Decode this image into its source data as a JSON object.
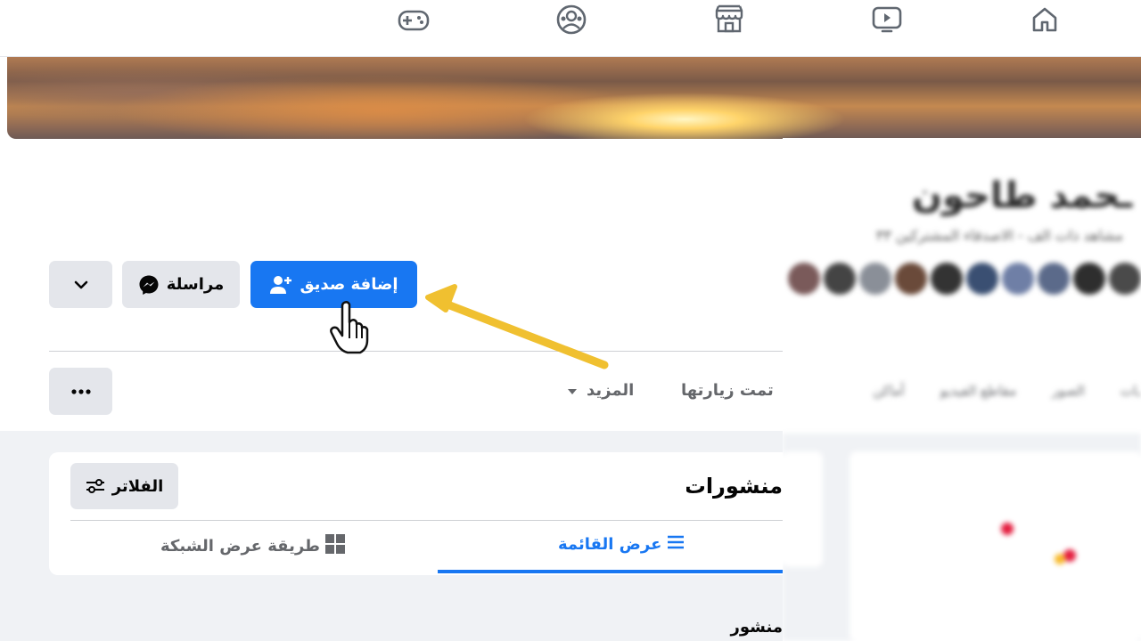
{
  "topnav": {
    "items": [
      {
        "icon": "home-icon"
      },
      {
        "icon": "watch-icon"
      },
      {
        "icon": "marketplace-icon"
      },
      {
        "icon": "groups-icon"
      },
      {
        "icon": "gaming-icon"
      }
    ]
  },
  "profile": {
    "actions": {
      "add_friend_label": "إضافة صديق",
      "message_label": "مراسلة"
    },
    "tabs": {
      "visited_label": "تمت زيارتها",
      "more_label": "المزيد"
    }
  },
  "posts": {
    "title": "منشورات",
    "filters_label": "الفلاتر",
    "list_view_label": "عرض القائمة",
    "grid_view_label": "طريقة عرض الشبكة",
    "pinned_label": "منشور مثبت"
  },
  "colors": {
    "accent": "#1877f2",
    "button_gray": "#e4e6eb",
    "annotation_arrow": "#f0c030"
  }
}
